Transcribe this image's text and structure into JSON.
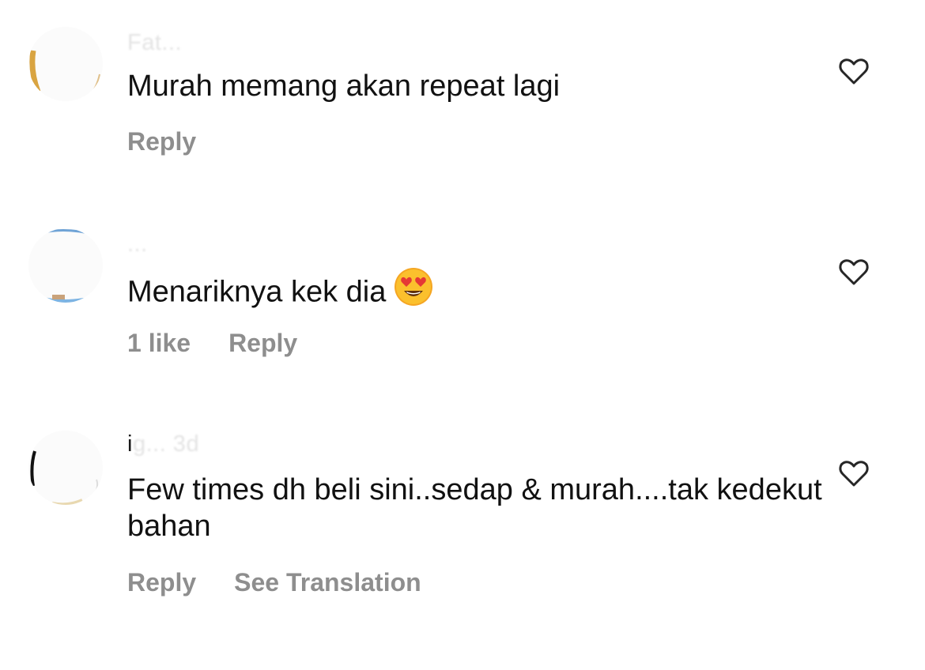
{
  "comments": [
    {
      "username_visible": "",
      "username_blurred": "Fat...",
      "text": "Murah memang akan repeat lagi",
      "likes": "",
      "reply_label": "Reply",
      "translation_label": ""
    },
    {
      "username_visible": "",
      "username_blurred": "...",
      "text": "Menariknya kek dia",
      "emoji": "heart-eyes-emoji",
      "likes": "1 like",
      "reply_label": "Reply",
      "translation_label": ""
    },
    {
      "username_visible": "i",
      "username_blurred": "g...   3d",
      "text": "Few times dh beli sini..sedap & murah....tak kedekut bahan",
      "likes": "",
      "reply_label": "Reply",
      "translation_label": "See Translation"
    }
  ],
  "icons": {
    "like": "heart-outline-icon"
  },
  "colors": {
    "text": "#111111",
    "secondary": "#8e8e8e",
    "background": "#ffffff"
  }
}
